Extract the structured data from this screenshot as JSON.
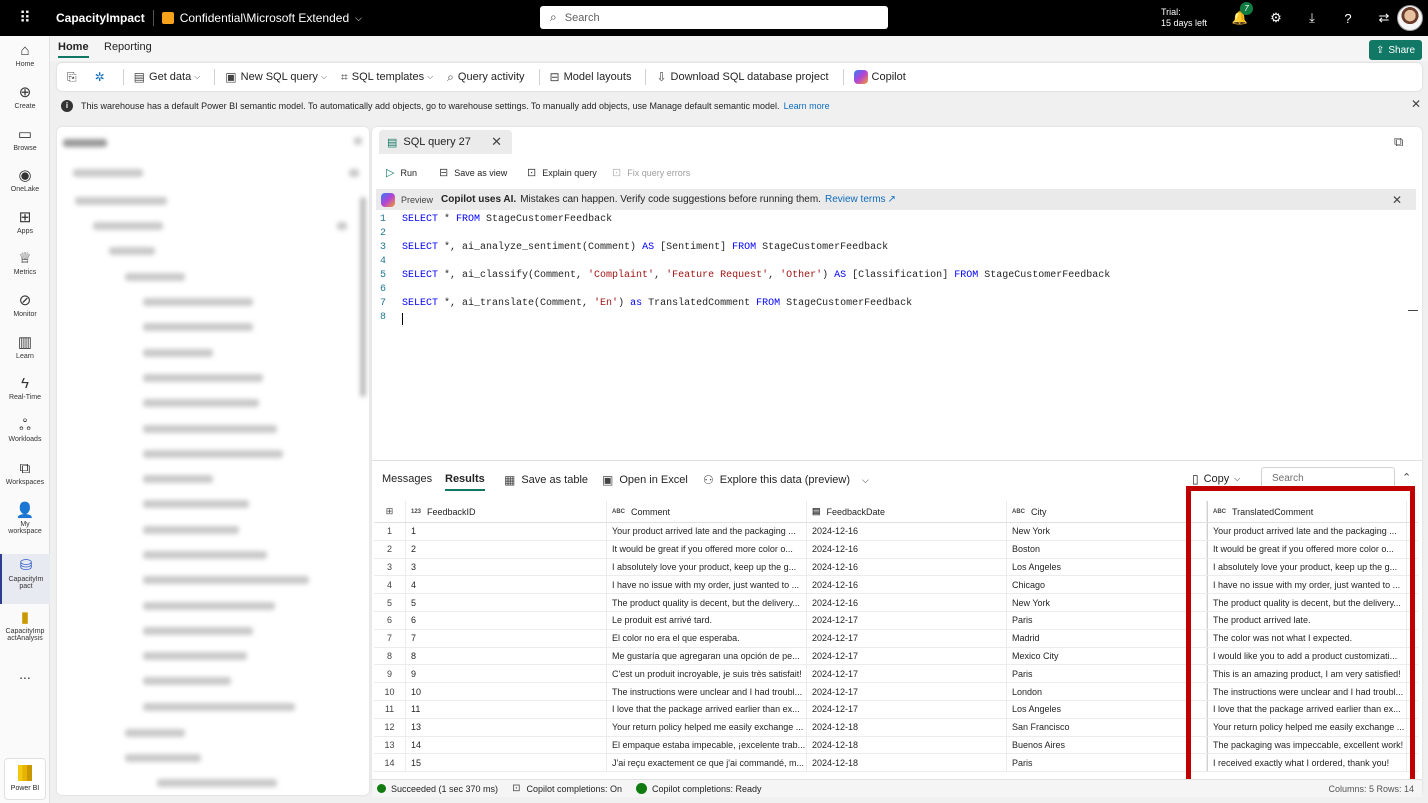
{
  "topbar": {
    "app_name": "CapacityImpact",
    "sensitivity": "Confidential\\Microsoft Extended",
    "search_placeholder": "Search",
    "trial_line1": "Trial:",
    "trial_line2": "15 days left",
    "notification_count": "7"
  },
  "rail": {
    "home": "Home",
    "create": "Create",
    "browse": "Browse",
    "onelake": "OneLake",
    "apps": "Apps",
    "metrics": "Metrics",
    "monitor": "Monitor",
    "learn": "Learn",
    "realtime": "Real-Time",
    "workloads": "Workloads",
    "workspaces": "Workspaces",
    "my_workspace_1": "My",
    "my_workspace_2": "workspace",
    "capacityimpact_1": "CapacityIm",
    "capacityimpact_2": "pact",
    "capacityanalysis_1": "CapacityImp",
    "capacityanalysis_2": "actAnalysis",
    "more": "...",
    "powerbi": "Power BI"
  },
  "ribbon": {
    "tab_home": "Home",
    "tab_reporting": "Reporting",
    "share": "Share",
    "get_data": "Get data",
    "new_sql_query": "New SQL query",
    "sql_templates": "SQL templates",
    "query_activity": "Query activity",
    "model_layouts": "Model layouts",
    "download_project": "Download SQL database project",
    "copilot": "Copilot"
  },
  "infobar": {
    "message": "This warehouse has a default Power BI semantic model. To automatically add objects, go to warehouse settings. To manually add objects, use Manage default semantic model.",
    "link": "Learn more"
  },
  "editor": {
    "tab_title": "SQL query 27",
    "run": "Run",
    "save_as_view": "Save as view",
    "explain_query": "Explain query",
    "fix_query_errors": "Fix query errors",
    "banner_preview": "Preview",
    "banner_bold": "Copilot uses AI.",
    "banner_text": "Mistakes can happen. Verify code suggestions before running them.",
    "banner_link": "Review terms",
    "code": {
      "l1_a": "SELECT",
      "l1_b": " * ",
      "l1_c": "FROM",
      "l1_d": " StageCustomerFeedback",
      "l3_a": "SELECT",
      "l3_b": " *, ai_analyze_sentiment(Comment) ",
      "l3_c": "AS",
      "l3_d": " [Sentiment] ",
      "l3_e": "FROM",
      "l3_f": " StageCustomerFeedback",
      "l5_a": "SELECT",
      "l5_b": " *, ai_classify(Comment, ",
      "l5_c": "'Complaint'",
      "l5_d": ", ",
      "l5_e": "'Feature Request'",
      "l5_f": ", ",
      "l5_g": "'Other'",
      "l5_h": ") ",
      "l5_i": "AS",
      "l5_j": " [Classification] ",
      "l5_k": "FROM",
      "l5_l": " StageCustomerFeedback",
      "l7_a": "SELECT",
      "l7_b": " *, ai_translate(Comment, ",
      "l7_c": "'En'",
      "l7_d": ") ",
      "l7_e": "as",
      "l7_f": " TranslatedComment ",
      "l7_g": "FROM",
      "l7_h": " StageCustomerFeedback"
    },
    "line_numbers": [
      "1",
      "2",
      "3",
      "4",
      "5",
      "6",
      "7",
      "8"
    ]
  },
  "results": {
    "tab_messages": "Messages",
    "tab_results": "Results",
    "save_as_table": "Save as table",
    "open_in_excel": "Open in Excel",
    "explore": "Explore this data (preview)",
    "copy": "Copy",
    "search_placeholder": "Search",
    "columns": [
      {
        "type": "123",
        "name": "FeedbackID"
      },
      {
        "type": "ABC",
        "name": "Comment"
      },
      {
        "type": "date-icon",
        "name": "FeedbackDate"
      },
      {
        "type": "ABC",
        "name": "City"
      },
      {
        "type": "ABC",
        "name": "TranslatedComment"
      }
    ],
    "rows": [
      [
        "1",
        "1",
        "Your product arrived late and the packaging ...",
        "2024-12-16",
        "New York",
        "Your product arrived late and the packaging ..."
      ],
      [
        "2",
        "2",
        "It would be great if you offered more color o...",
        "2024-12-16",
        "Boston",
        "It would be great if you offered more color o..."
      ],
      [
        "3",
        "3",
        "I absolutely love your product, keep up the g...",
        "2024-12-16",
        "Los Angeles",
        "I absolutely love your product, keep up the g..."
      ],
      [
        "4",
        "4",
        "I have no issue with my order, just wanted to ...",
        "2024-12-16",
        "Chicago",
        "I have no issue with my order, just wanted to ..."
      ],
      [
        "5",
        "5",
        "The product quality is decent, but the delivery...",
        "2024-12-16",
        "New York",
        "The product quality is decent, but the delivery..."
      ],
      [
        "6",
        "6",
        "Le produit est arrivé tard.",
        "2024-12-17",
        "Paris",
        "The product arrived late."
      ],
      [
        "7",
        "7",
        "El color no era el que esperaba.",
        "2024-12-17",
        "Madrid",
        "The color was not what I expected."
      ],
      [
        "8",
        "8",
        "Me gustaría que agregaran una opción de pe...",
        "2024-12-17",
        "Mexico City",
        "I would like you to add a product customizati..."
      ],
      [
        "9",
        "9",
        "C'est un produit incroyable, je suis très satisfait!",
        "2024-12-17",
        "Paris",
        "This is an amazing product, I am very satisfied!"
      ],
      [
        "10",
        "10",
        "The instructions were unclear and I had troubl...",
        "2024-12-17",
        "London",
        "The instructions were unclear and I had troubl..."
      ],
      [
        "11",
        "11",
        "I love that the package arrived earlier than ex...",
        "2024-12-17",
        "Los Angeles",
        "I love that the package arrived earlier than ex..."
      ],
      [
        "12",
        "13",
        "Your return policy helped me easily exchange ...",
        "2024-12-18",
        "San Francisco",
        "Your return policy helped me easily exchange ..."
      ],
      [
        "13",
        "14",
        "El empaque estaba impecable, ¡excelente trab...",
        "2024-12-18",
        "Buenos Aires",
        "The packaging was impeccable, excellent work!"
      ],
      [
        "14",
        "15",
        "J'ai reçu exactement ce que j'ai commandé, m...",
        "2024-12-18",
        "Paris",
        "I received exactly what I ordered, thank you!"
      ]
    ]
  },
  "status": {
    "succeeded": "Succeeded (1 sec 370 ms)",
    "copilot_on": "Copilot completions: On",
    "copilot_ready": "Copilot completions: Ready",
    "cols_rows": "Columns: 5 Rows: 14"
  },
  "colors": {
    "accent": "#117865",
    "highlight": "#c00000",
    "keyword": "#0000ff",
    "string": "#a31515"
  }
}
